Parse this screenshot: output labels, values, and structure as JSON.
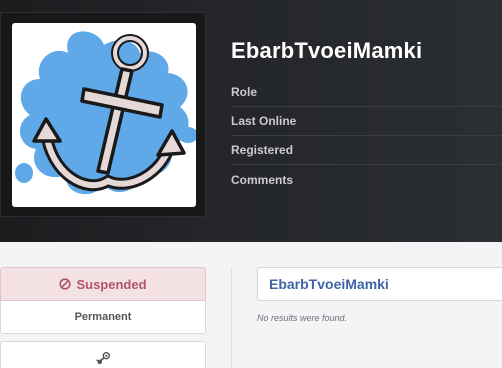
{
  "profile": {
    "username": "EbarbTvoeiMamki",
    "avatar_icon": "anchor-icon"
  },
  "info_rows": [
    {
      "label": "Role"
    },
    {
      "label": "Last Online"
    },
    {
      "label": "Registered"
    },
    {
      "label": "Comments"
    }
  ],
  "ban": {
    "status": "Suspended",
    "status_icon": "ban-icon",
    "duration": "Permanent",
    "status_color": "#b0566a"
  },
  "steam": {
    "icon": "steam-icon"
  },
  "content": {
    "name_card": "EbarbTvoeiMamki",
    "empty_message": "No results were found."
  }
}
